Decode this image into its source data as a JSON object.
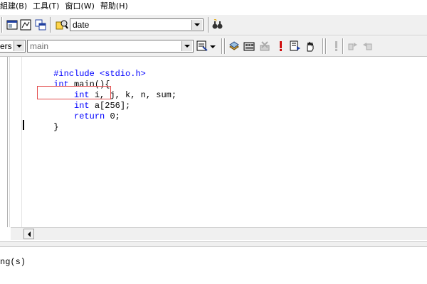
{
  "menubar": {
    "items": [
      "組建(B)",
      "工具(T)",
      "窗口(W)",
      "帮助(H)"
    ]
  },
  "toolbar1": {
    "find_combo_value": "date"
  },
  "toolbar2": {
    "class_combo_value": "ers",
    "function_combo_value": "main"
  },
  "editor": {
    "lines": [
      "#include <stdio.h>",
      "int main(){",
      "    int i, j, k, n, sum;",
      "    int a[256];",
      "    return 0;",
      "}"
    ]
  },
  "output": {
    "visible_text": "ng(s)"
  },
  "colors": {
    "keyword": "#0000ff",
    "highlight_border": "#e34a4a",
    "toolbar_bg": "#f0f0f0"
  }
}
